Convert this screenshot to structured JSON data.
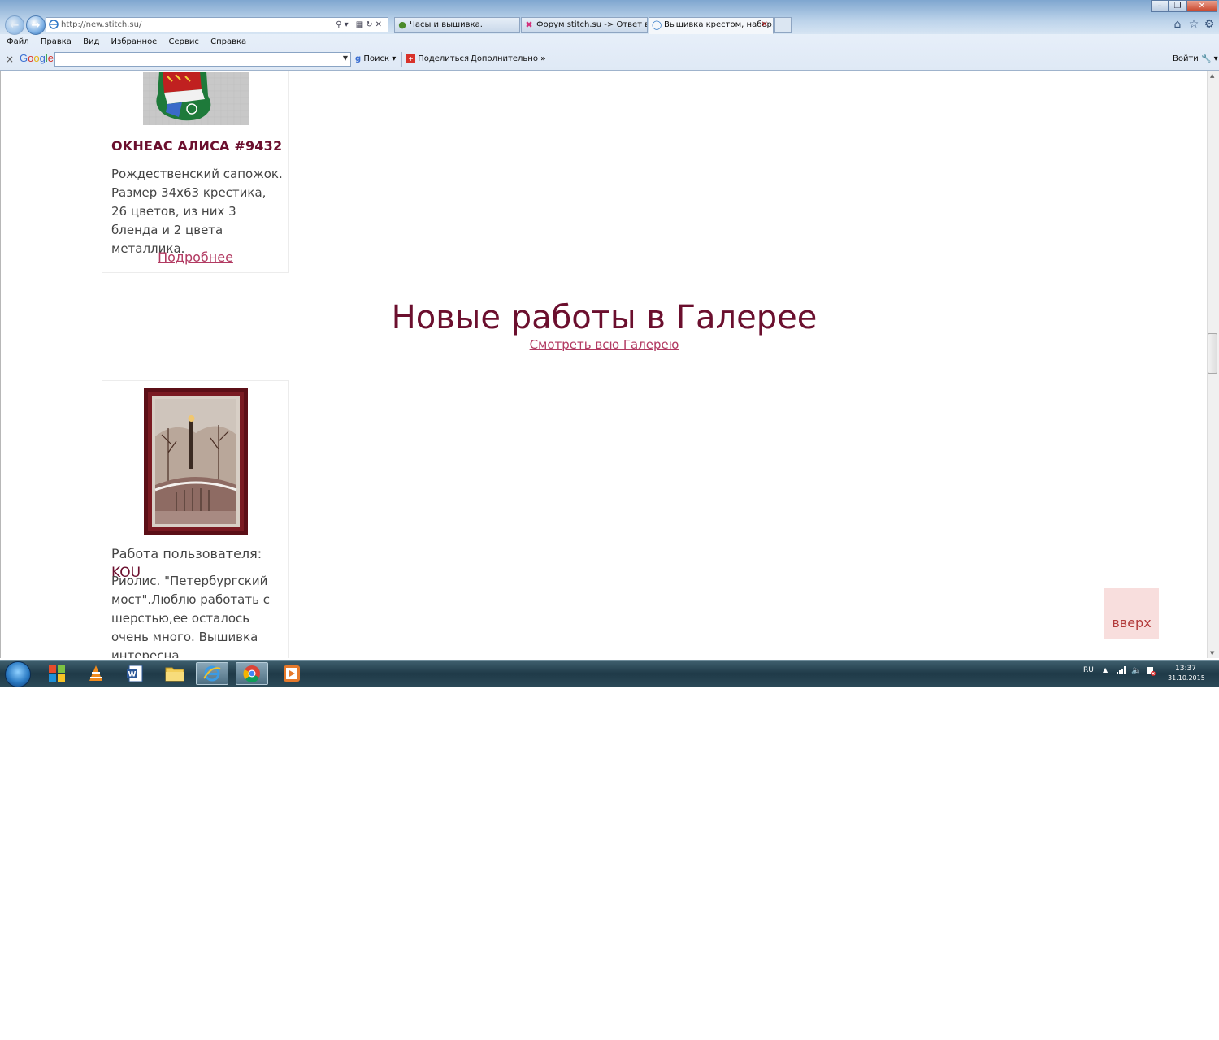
{
  "browser": {
    "address_url": "http://new.stitch.su/",
    "tabs": [
      {
        "label": "Часы и вышивка.",
        "icon": "globe-icon"
      },
      {
        "label": "Форум stitch.su -> Ответ в Но...",
        "icon": "stitch-icon"
      },
      {
        "label": "Вышивка крестом, набор...",
        "icon": "ie-icon",
        "active": true
      }
    ],
    "menu": [
      "Файл",
      "Правка",
      "Вид",
      "Избранное",
      "Сервис",
      "Справка"
    ],
    "google_bar": {
      "logo": "Google",
      "search_label": "Поиск",
      "share_label": "Поделиться",
      "more_label": "Дополнительно",
      "signin_label": "Войти"
    }
  },
  "page": {
    "product": {
      "title": "OKHEAC АЛИСА #9432",
      "description": "Рождественский сапожок. Размер 34x63 крестика, 26 цветов, из них 3 бленда и 2 цвета металлика.",
      "more_link": "Подробнее"
    },
    "gallery": {
      "heading": "Новые работы в Галерее",
      "all_link": "Смотреть всю Галерею",
      "item": {
        "author_prefix": "Работа пользователя:",
        "author": "KOU",
        "description": "Риолис. \"Петербургский мост\".Люблю работать с шерстью,ее осталось очень много. Вышивка интересна"
      }
    },
    "scroll_top_label": "вверх"
  },
  "taskbar": {
    "language": "RU",
    "time": "13:37",
    "date": "31.10.2015"
  },
  "colors": {
    "brand": "#6b0f2e",
    "link": "#b23a62",
    "scroll_top_bg": "#f8dedd"
  }
}
